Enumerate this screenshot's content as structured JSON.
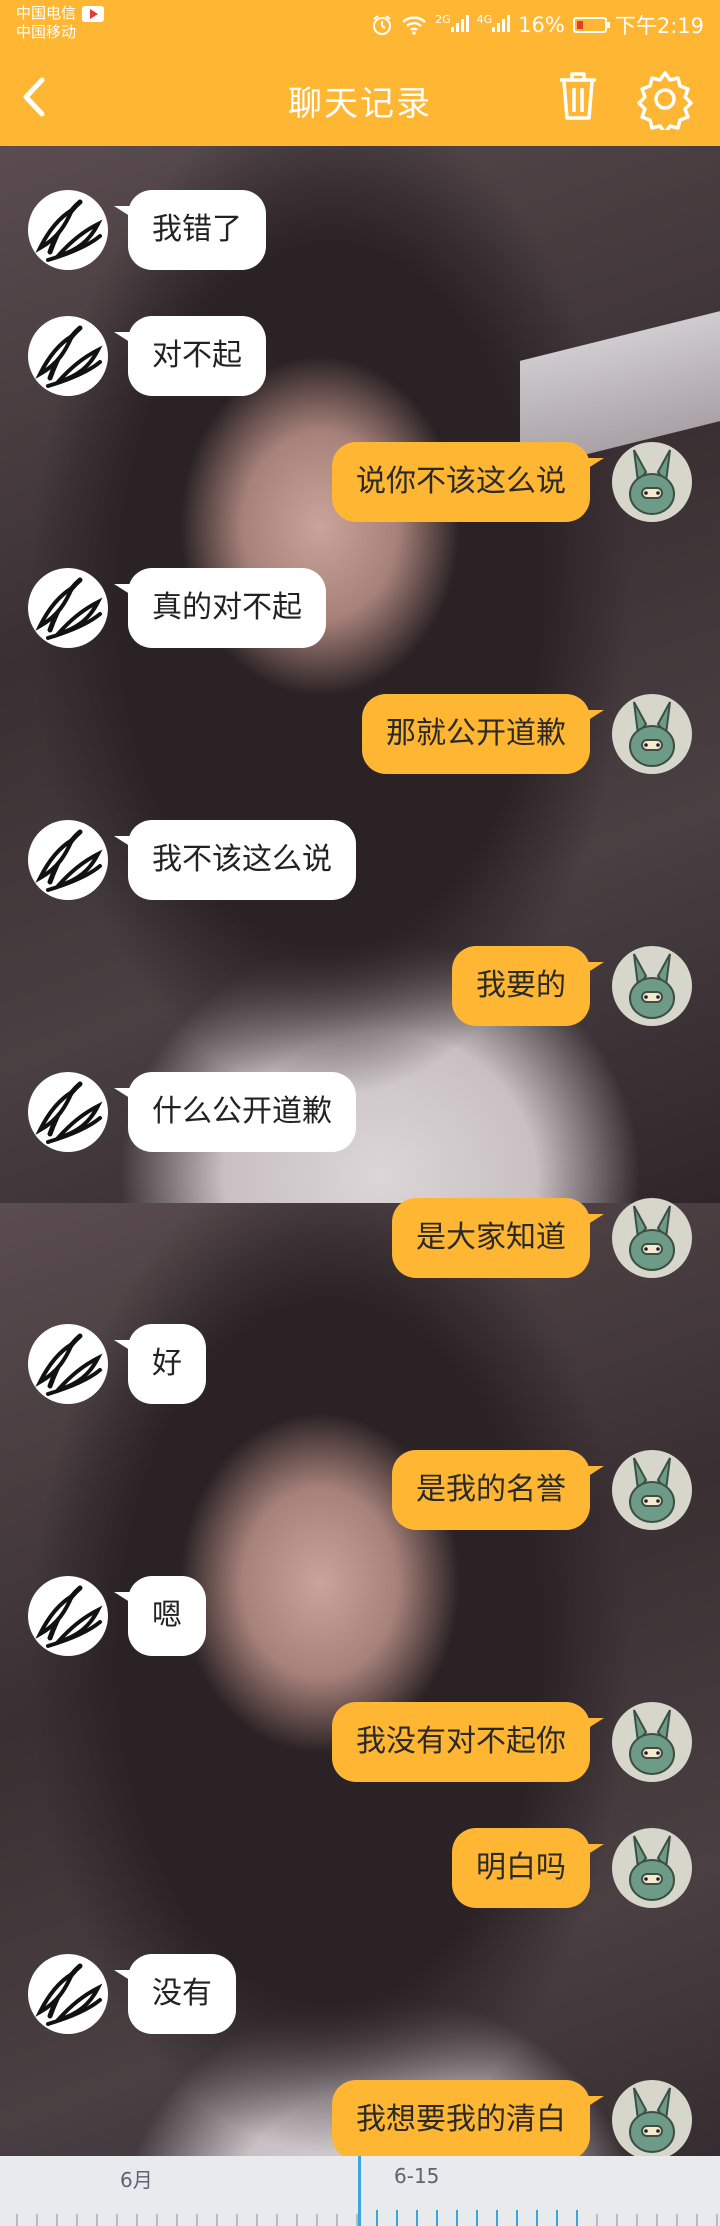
{
  "status_bar": {
    "carrier_1": "中国电信",
    "carrier_2": "中国移动",
    "network_1": "2G",
    "network_2": "4G",
    "battery": "16%",
    "time": "下午2:19"
  },
  "header": {
    "title": "聊天记录",
    "icons": [
      "back-icon",
      "trash-icon",
      "gear-icon"
    ]
  },
  "colors": {
    "accent": "#ffb632",
    "my_bubble": "#ffb632",
    "their_bubble": "#ffffff",
    "timeline_marker": "#3aa6e0"
  },
  "messages": [
    {
      "side": "them",
      "text": "我错了"
    },
    {
      "side": "them",
      "text": "对不起"
    },
    {
      "side": "me",
      "text": "说你不该这么说"
    },
    {
      "side": "them",
      "text": "真的对不起"
    },
    {
      "side": "me",
      "text": "那就公开道歉"
    },
    {
      "side": "them",
      "text": "我不该这么说"
    },
    {
      "side": "me",
      "text": "我要的"
    },
    {
      "side": "them",
      "text": "什么公开道歉"
    },
    {
      "side": "me",
      "text": "是大家知道"
    },
    {
      "side": "them",
      "text": "好"
    },
    {
      "side": "me",
      "text": "是我的名誉"
    },
    {
      "side": "them",
      "text": "嗯"
    },
    {
      "side": "me",
      "text": "我没有对不起你"
    },
    {
      "side": "me",
      "text": "明白吗"
    },
    {
      "side": "them",
      "text": "没有"
    },
    {
      "side": "me",
      "text": "我想要我的清白"
    }
  ],
  "timeline": {
    "labels": [
      "6月",
      "6-15"
    ]
  }
}
